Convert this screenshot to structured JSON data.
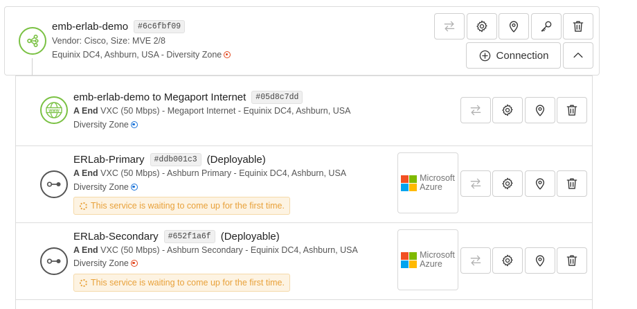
{
  "parent": {
    "title": "emb-erlab-demo",
    "tag": "#6c6fbf09",
    "vendor_line": "Vendor: Cisco, Size: MVE 2/8",
    "location_line": "Equinix DC4, Ashburn, USA - Diversity Zone",
    "diversity_zone_color": "red",
    "connection_label": "Connection"
  },
  "services": [
    {
      "title": "emb-erlab-demo to Megaport Internet",
      "tag": "#05d8c7dd",
      "deployable": "",
      "a_end": "A End",
      "detail": "VXC (50 Mbps) - Megaport Internet - Equinix DC4, Ashburn, USA",
      "diversity": "Diversity Zone",
      "diversity_zone_color": "blue",
      "icon": "internet-globe-icon",
      "warning": "",
      "partner": ""
    },
    {
      "title": "ERLab-Primary",
      "tag": "#ddb001c3",
      "deployable": "(Deployable)",
      "a_end": "A End",
      "detail": "VXC (50 Mbps) - Ashburn Primary - Equinix DC4, Ashburn, USA",
      "diversity": "Diversity Zone",
      "diversity_zone_color": "blue",
      "icon": "vxc-connection-icon",
      "warning": "This service is waiting to come up for the first time.",
      "partner": {
        "line1": "Microsoft",
        "line2": "Azure"
      }
    },
    {
      "title": "ERLab-Secondary",
      "tag": "#652f1a6f",
      "deployable": "(Deployable)",
      "a_end": "A End",
      "detail": "VXC (50 Mbps) - Ashburn Secondary - Equinix DC4, Ashburn, USA",
      "diversity": "Diversity Zone",
      "diversity_zone_color": "red",
      "icon": "vxc-connection-icon",
      "warning": "This service is waiting to come up for the first time.",
      "partner": {
        "line1": "Microsoft",
        "line2": "Azure"
      }
    }
  ],
  "colors": {
    "accent_green": "#7ac143",
    "zone_red": "#e2471f",
    "zone_blue": "#1a73d9",
    "warning_text": "#e8a13a",
    "warning_bg": "#fdf3e2"
  }
}
